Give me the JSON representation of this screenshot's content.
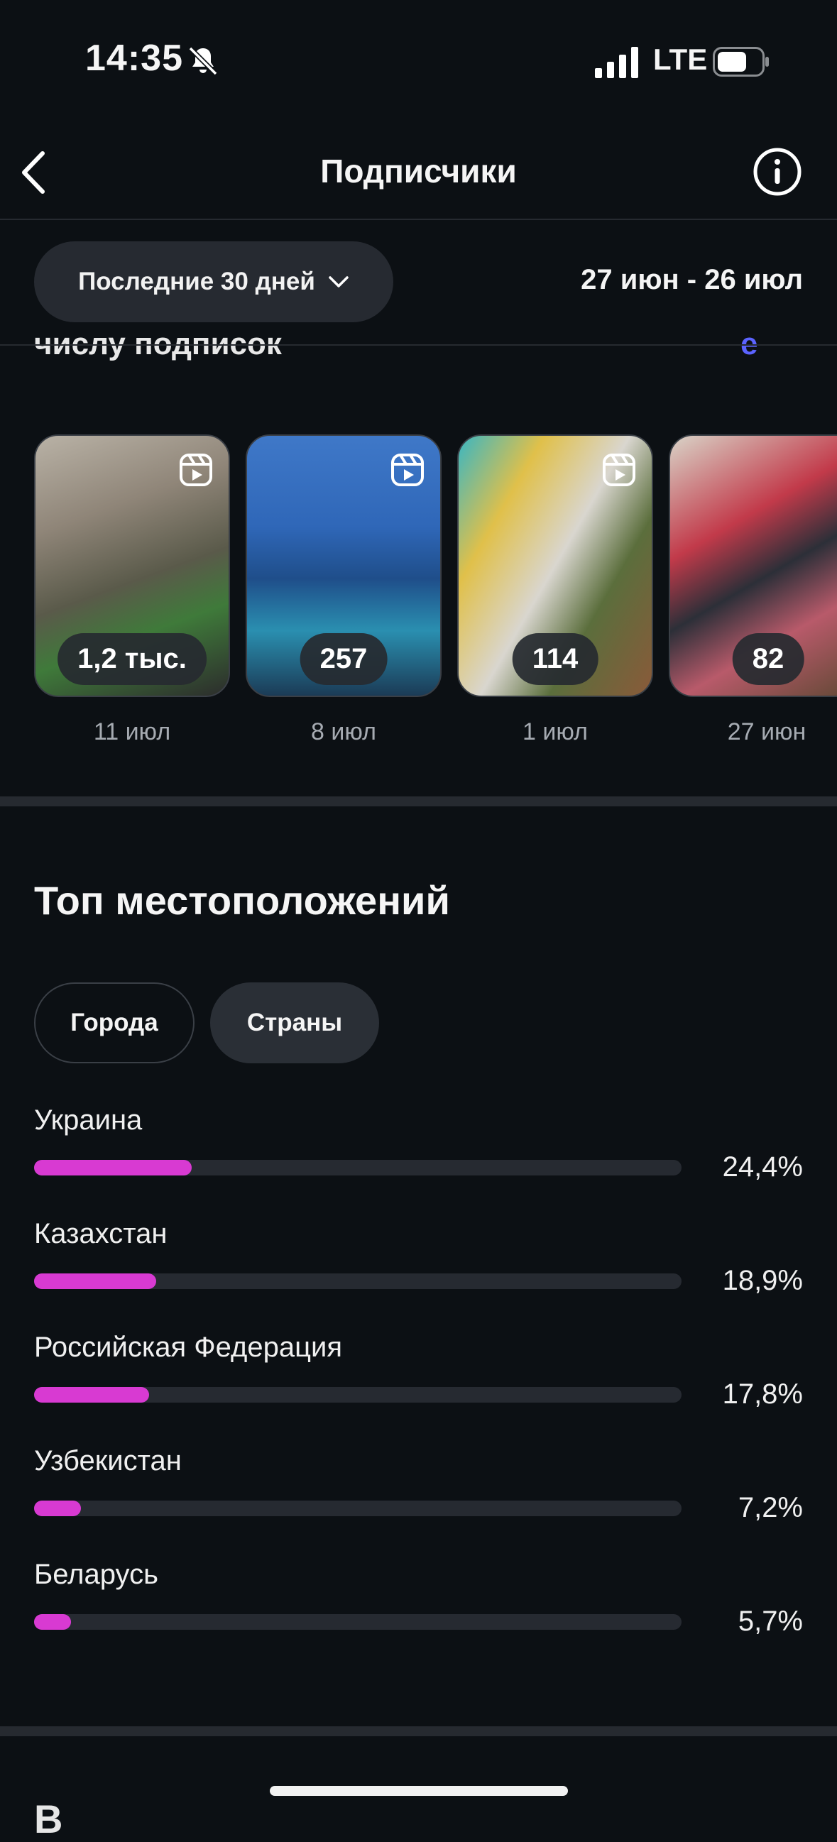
{
  "status_bar": {
    "time": "14:35",
    "network": "LTE",
    "icons": [
      "bell-slash-icon",
      "signal-icon",
      "battery-icon"
    ]
  },
  "header": {
    "title": "Подписчики",
    "back_icon": "chevron-left-icon",
    "info_icon": "info-icon"
  },
  "filter": {
    "period_label": "Последние 30 дней",
    "date_range": "27 июн - 26 июл"
  },
  "section_partial": {
    "title_tail": "числу подписок",
    "link_tail": "е"
  },
  "reels": [
    {
      "count": "1,2 тыс.",
      "date": "11 июл"
    },
    {
      "count": "257",
      "date": "8 июл"
    },
    {
      "count": "114",
      "date": "1 июл"
    },
    {
      "count": "82",
      "date": "27 июн"
    }
  ],
  "top_locations": {
    "title": "Топ местоположений",
    "tabs": [
      {
        "label": "Города",
        "selected": false
      },
      {
        "label": "Страны",
        "selected": true
      }
    ],
    "accent_color": "#d83ad2",
    "items": [
      {
        "name": "Украина",
        "percent_label": "24,4%",
        "value": 24.4
      },
      {
        "name": "Казахстан",
        "percent_label": "18,9%",
        "value": 18.9
      },
      {
        "name": "Российская Федерация",
        "percent_label": "17,8%",
        "value": 17.8
      },
      {
        "name": "Узбекистан",
        "percent_label": "7,2%",
        "value": 7.2
      },
      {
        "name": "Беларусь",
        "percent_label": "5,7%",
        "value": 5.7
      }
    ]
  },
  "bottom_partial": {
    "title_head": "В"
  }
}
